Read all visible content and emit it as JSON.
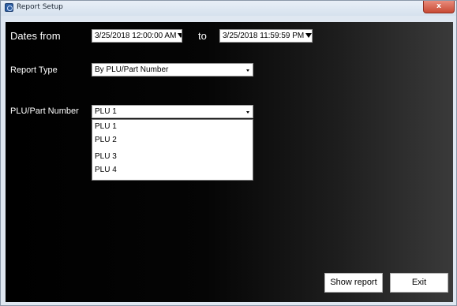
{
  "window": {
    "title": "Report Setup",
    "close_label": "x"
  },
  "dates": {
    "from_label": "Dates from",
    "from_value": "3/25/2018 12:00:00 AM",
    "to_label": "to",
    "to_value": "3/25/2018 11:59:59 PM"
  },
  "report_type": {
    "label": "Report Type",
    "value": "By PLU/Part Number"
  },
  "plu": {
    "label": "PLU/Part Number",
    "value": "PLU 1",
    "options": [
      "PLU 1",
      "PLU 2",
      "PLU 3",
      "PLU 4"
    ]
  },
  "buttons": {
    "show_report": "Show report",
    "exit": "Exit"
  },
  "icons": {
    "app": "report-app-icon",
    "close": "close-icon",
    "date_dropdown": "triangle-down-icon",
    "combo_dropdown": "chevron-down-icon"
  }
}
